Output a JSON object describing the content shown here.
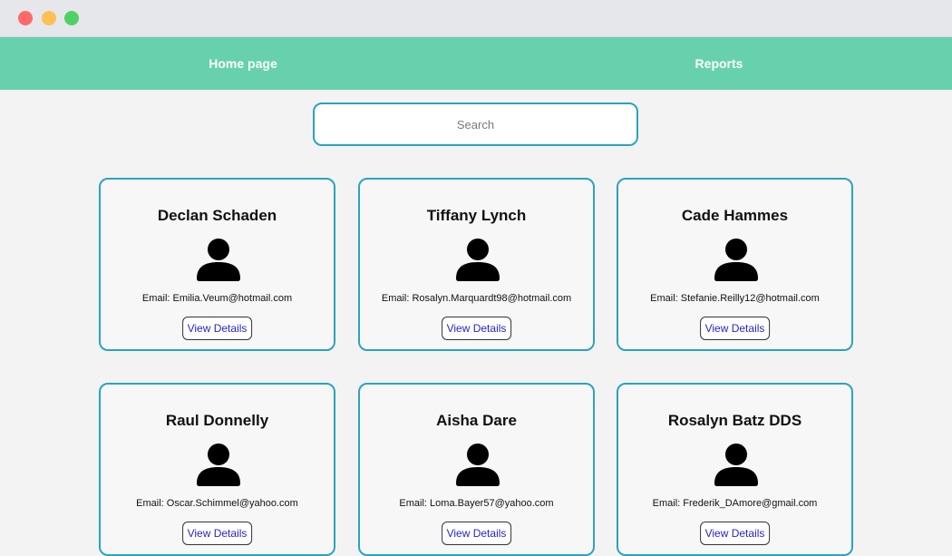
{
  "nav": {
    "home_label": "Home page",
    "reports_label": "Reports"
  },
  "search": {
    "placeholder": "Search",
    "value": ""
  },
  "cards": [
    {
      "name": "Declan Schaden",
      "email": "Email: Emilia.Veum@hotmail.com",
      "button": "View Details"
    },
    {
      "name": "Tiffany Lynch",
      "email": "Email: Rosalyn.Marquardt98@hotmail.com",
      "button": "View Details"
    },
    {
      "name": "Cade Hammes",
      "email": "Email: Stefanie.Reilly12@hotmail.com",
      "button": "View Details"
    },
    {
      "name": "Raul Donnelly",
      "email": "Email: Oscar.Schimmel@yahoo.com",
      "button": "View Details"
    },
    {
      "name": "Aisha Dare",
      "email": "Email: Loma.Bayer57@yahoo.com",
      "button": "View Details"
    },
    {
      "name": "Rosalyn Batz DDS",
      "email": "Email: Frederik_DAmore@gmail.com",
      "button": "View Details"
    }
  ],
  "icons": {
    "avatar": "person-icon",
    "window_controls": [
      "close-icon",
      "minimize-icon",
      "maximize-icon"
    ]
  },
  "colors": {
    "navbar": "#67d1ad",
    "card_border": "#2ba3c0",
    "link": "#2525c8"
  }
}
